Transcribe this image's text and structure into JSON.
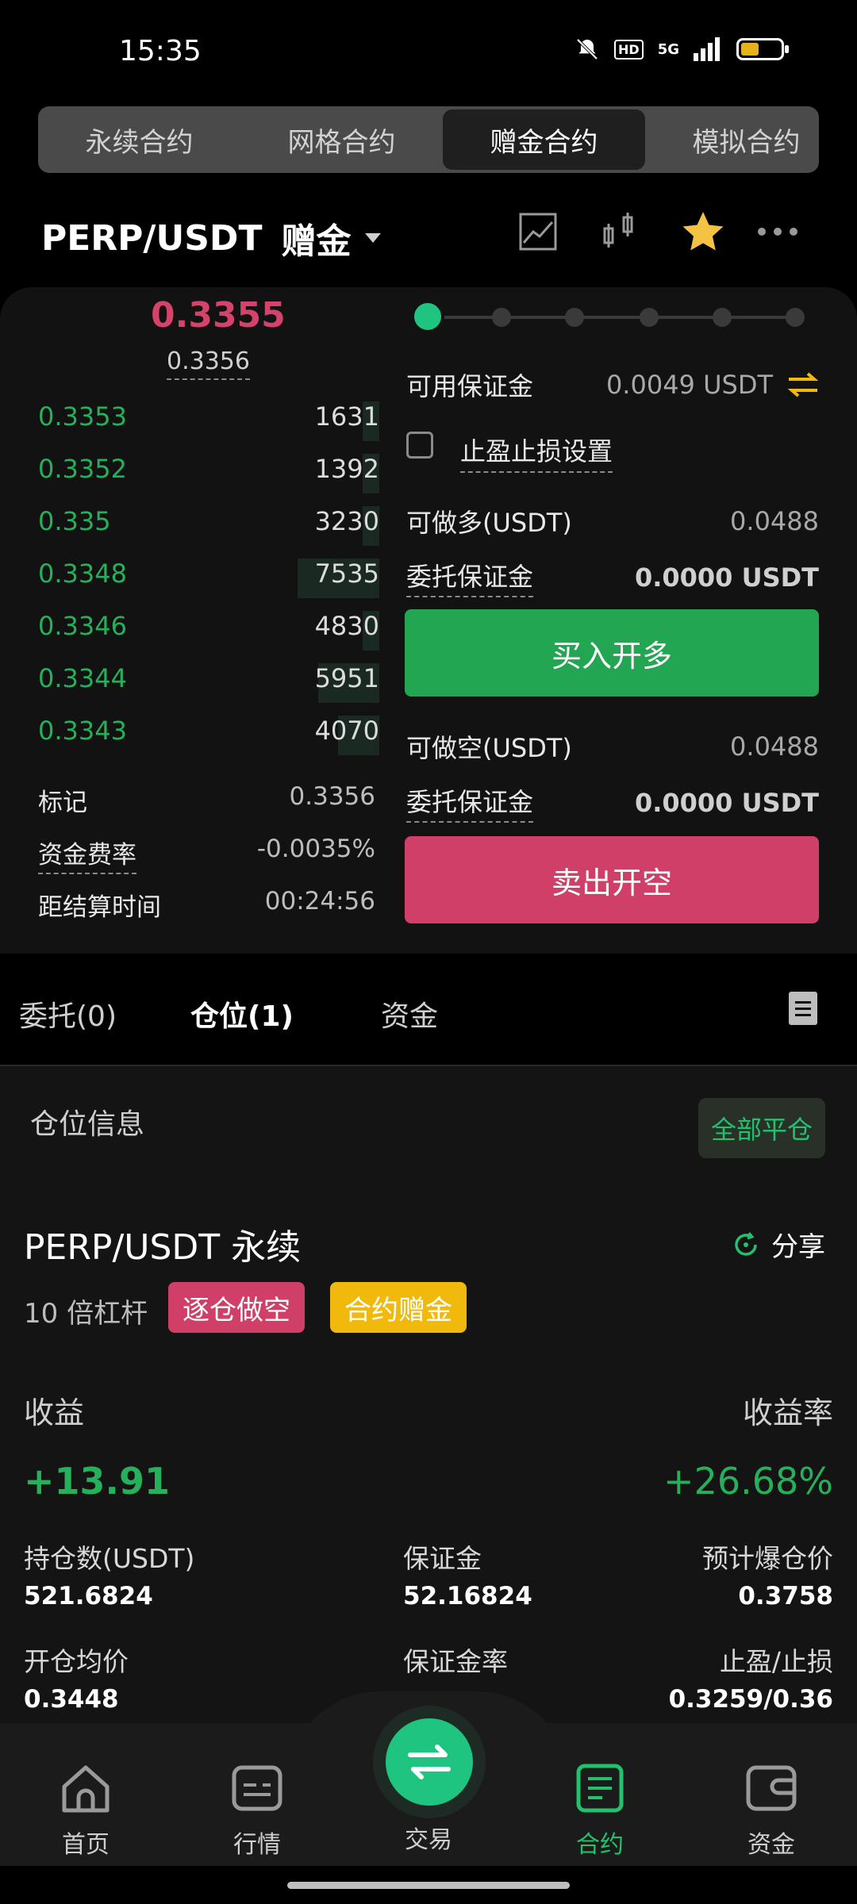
{
  "status": {
    "time": "15:35",
    "network": "5G",
    "hd": "HD"
  },
  "top_tabs": [
    {
      "label": "永续合约",
      "active": false
    },
    {
      "label": "网格合约",
      "active": false
    },
    {
      "label": "赠金合约",
      "active": true
    },
    {
      "label": "模拟合约",
      "active": false
    }
  ],
  "header": {
    "pair": "PERP/USDT",
    "mode": "赠金"
  },
  "orderbook": {
    "last_price": "0.3355",
    "mark_price": "0.3356",
    "bids": [
      {
        "price": "0.3353",
        "size": "1631",
        "depth": 0.05
      },
      {
        "price": "0.3352",
        "size": "1392",
        "depth": 0.05
      },
      {
        "price": "0.335",
        "size": "3230",
        "depth": 0.05
      },
      {
        "price": "0.3348",
        "size": "7535",
        "depth": 0.24
      },
      {
        "price": "0.3346",
        "size": "4830",
        "depth": 0.05
      },
      {
        "price": "0.3344",
        "size": "5951",
        "depth": 0.18
      },
      {
        "price": "0.3343",
        "size": "4070",
        "depth": 0.12
      }
    ]
  },
  "market_info": {
    "mark_label": "标记",
    "mark_value": "0.3356",
    "funding_label": "资金费率",
    "funding_value": "-0.0035%",
    "settle_label": "距结算时间",
    "settle_value": "00:24:56"
  },
  "order_panel": {
    "slider_percent": 0,
    "avail_label": "可用保证金",
    "avail_value": "0.0049 USDT",
    "tpsl_label": "止盈止损设置",
    "long_label": "可做多(USDT)",
    "long_value": "0.0488",
    "long_margin_label": "委托保证金",
    "long_margin_value": "0.0000 USDT",
    "buy_label": "买入开多",
    "short_label": "可做空(USDT)",
    "short_value": "0.0488",
    "short_margin_label": "委托保证金",
    "short_margin_value": "0.0000 USDT",
    "sell_label": "卖出开空"
  },
  "sub_tabs": [
    {
      "label": "委托(0)",
      "active": false
    },
    {
      "label": "仓位(1)",
      "active": true
    },
    {
      "label": "资金",
      "active": false
    }
  ],
  "position": {
    "section_title": "仓位信息",
    "close_all": "全部平仓",
    "name": "PERP/USDT 永续",
    "share": "分享",
    "leverage": "10 倍杠杆",
    "side_badge": "逐仓做空",
    "bonus_badge": "合约赠金",
    "pnl_label": "收益",
    "pnl_value": "+13.91",
    "roe_label": "收益率",
    "roe_value": "+26.68%",
    "size_label": "持仓数(USDT)",
    "size_value": "521.6824",
    "margin_label": "保证金",
    "margin_value": "52.16824",
    "liq_label": "预计爆仓价",
    "liq_value": "0.3758",
    "entry_label": "开仓均价",
    "entry_value": "0.3448",
    "margin_ratio_label": "保证金率",
    "tpsl_label": "止盈/止损",
    "tpsl_value": "0.3259/0.36"
  },
  "bottom_nav": [
    {
      "label": "首页",
      "active": false
    },
    {
      "label": "行情",
      "active": false
    },
    {
      "label": "交易",
      "active": false
    },
    {
      "label": "合约",
      "active": true
    },
    {
      "label": "资金",
      "active": false
    }
  ],
  "colors": {
    "green": "#25b15c",
    "red": "#cf3f67",
    "accent": "#1ec47f",
    "gold": "#f0b90b"
  }
}
